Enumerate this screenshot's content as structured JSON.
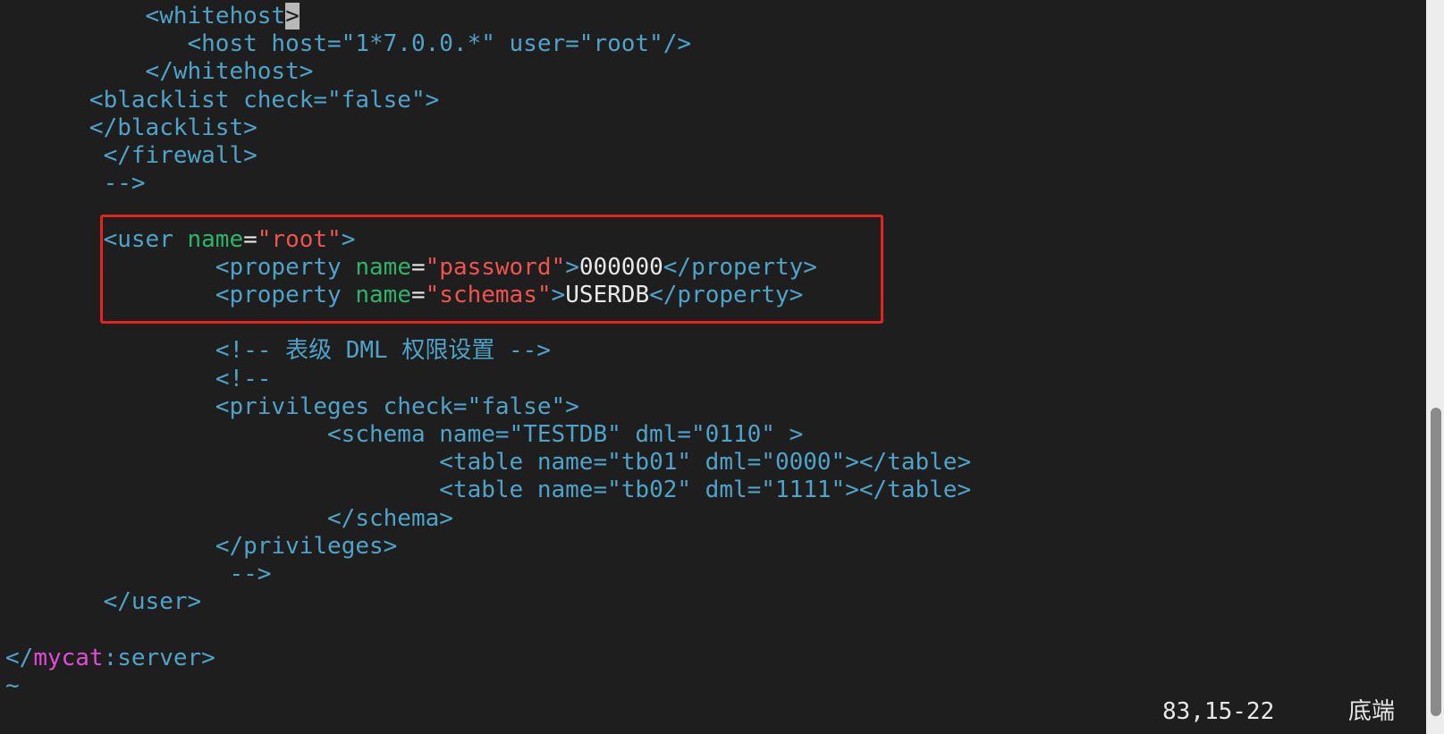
{
  "editor": {
    "lines": [
      {
        "indent": "          ",
        "segments": [
          {
            "text": "<whitehost",
            "cls": "tag"
          },
          {
            "text": ">",
            "cls": "cursor"
          }
        ]
      },
      {
        "indent": "             ",
        "segments": [
          {
            "text": "<host host=\"1*7.0.0.*\" user=\"root\"/>",
            "cls": "tag"
          }
        ]
      },
      {
        "indent": "          ",
        "segments": [
          {
            "text": "</whitehost>",
            "cls": "tag"
          }
        ]
      },
      {
        "indent": "      ",
        "segments": [
          {
            "text": "<blacklist check=\"false\">",
            "cls": "tag"
          }
        ]
      },
      {
        "indent": "      ",
        "segments": [
          {
            "text": "</blacklist>",
            "cls": "tag"
          }
        ]
      },
      {
        "indent": "       ",
        "segments": [
          {
            "text": "</firewall>",
            "cls": "tag"
          }
        ]
      },
      {
        "indent": "       ",
        "segments": [
          {
            "text": "-->",
            "cls": "tag"
          }
        ]
      },
      {
        "indent": "",
        "segments": []
      },
      {
        "indent": "       ",
        "segments": [
          {
            "text": "<user ",
            "cls": "tag"
          },
          {
            "text": "name",
            "cls": "attr-green"
          },
          {
            "text": "=",
            "cls": "txt-white"
          },
          {
            "text": "\"root\"",
            "cls": "str-red"
          },
          {
            "text": ">",
            "cls": "tag"
          }
        ]
      },
      {
        "indent": "               ",
        "segments": [
          {
            "text": "<property ",
            "cls": "tag"
          },
          {
            "text": "name",
            "cls": "attr-green"
          },
          {
            "text": "=",
            "cls": "txt-white"
          },
          {
            "text": "\"password\"",
            "cls": "str-red"
          },
          {
            "text": ">",
            "cls": "tag"
          },
          {
            "text": "000000",
            "cls": "txt-white"
          },
          {
            "text": "</property>",
            "cls": "tag"
          }
        ]
      },
      {
        "indent": "               ",
        "segments": [
          {
            "text": "<property ",
            "cls": "tag"
          },
          {
            "text": "name",
            "cls": "attr-green"
          },
          {
            "text": "=",
            "cls": "txt-white"
          },
          {
            "text": "\"schemas\"",
            "cls": "str-red"
          },
          {
            "text": ">",
            "cls": "tag"
          },
          {
            "text": "USERDB",
            "cls": "txt-white"
          },
          {
            "text": "</property>",
            "cls": "tag"
          }
        ]
      },
      {
        "indent": "",
        "segments": []
      },
      {
        "indent": "               ",
        "segments": [
          {
            "text": "<!-- 表级 DML 权限设置 -->",
            "cls": "tag"
          }
        ]
      },
      {
        "indent": "               ",
        "segments": [
          {
            "text": "<!--",
            "cls": "tag"
          }
        ]
      },
      {
        "indent": "               ",
        "segments": [
          {
            "text": "<privileges check=\"false\">",
            "cls": "tag"
          }
        ]
      },
      {
        "indent": "                       ",
        "segments": [
          {
            "text": "<schema name=\"TESTDB\" dml=\"0110\" >",
            "cls": "tag"
          }
        ]
      },
      {
        "indent": "                               ",
        "segments": [
          {
            "text": "<table name=\"tb01\" dml=\"0000\"></table>",
            "cls": "tag"
          }
        ]
      },
      {
        "indent": "                               ",
        "segments": [
          {
            "text": "<table name=\"tb02\" dml=\"1111\"></table>",
            "cls": "tag"
          }
        ]
      },
      {
        "indent": "                       ",
        "segments": [
          {
            "text": "</schema>",
            "cls": "tag"
          }
        ]
      },
      {
        "indent": "               ",
        "segments": [
          {
            "text": "</privileges>",
            "cls": "tag"
          }
        ]
      },
      {
        "indent": "                ",
        "segments": [
          {
            "text": "-->",
            "cls": "tag"
          }
        ]
      },
      {
        "indent": "       ",
        "segments": [
          {
            "text": "</user>",
            "cls": "tag"
          }
        ]
      },
      {
        "indent": "",
        "segments": []
      },
      {
        "indent": "",
        "segments": [
          {
            "text": "</",
            "cls": "tag"
          },
          {
            "text": "mycat",
            "cls": "kw-magenta"
          },
          {
            "text": ":",
            "cls": "tag"
          },
          {
            "text": "server>",
            "cls": "tag"
          }
        ]
      },
      {
        "indent": "",
        "segments": [
          {
            "text": "~",
            "cls": "tilde"
          }
        ]
      }
    ]
  },
  "status": {
    "cursor_position": "83,15-22",
    "scroll_position": "底端"
  },
  "colors": {
    "background": "#1e1e1e",
    "tag": "#4fa3c9",
    "attribute": "#2fb36b",
    "string": "#ef5350",
    "text": "#e8e8e8",
    "namespace": "#e04bd6",
    "highlight_border": "#e5231e"
  }
}
